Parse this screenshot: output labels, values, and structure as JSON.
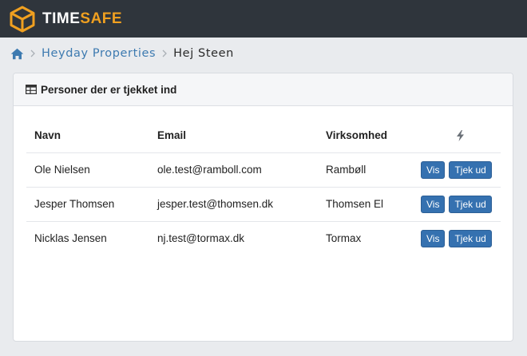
{
  "app": {
    "brand_part1": "TIME",
    "brand_part2": "SAFE",
    "colors": {
      "topbar": "#2f353c",
      "accent": "#f0a020",
      "link": "#3d7ab0",
      "button": "#3571b0"
    }
  },
  "breadcrumb": {
    "home_icon": "home-icon",
    "items": [
      {
        "label": "Heyday Properties"
      },
      {
        "label": "Hej Steen"
      }
    ]
  },
  "card": {
    "icon": "table-icon",
    "title": "Personer der er tjekket ind",
    "columns": {
      "name": "Navn",
      "email": "Email",
      "company": "Virksomhed",
      "actions_icon": "bolt-icon"
    },
    "rows": [
      {
        "name": "Ole Nielsen",
        "email": "ole.test@ramboll.com",
        "company": "Rambøll",
        "view": "Vis",
        "checkout": "Tjek ud"
      },
      {
        "name": "Jesper Thomsen",
        "email": "jesper.test@thomsen.dk",
        "company": "Thomsen El",
        "view": "Vis",
        "checkout": "Tjek ud"
      },
      {
        "name": "Nicklas Jensen",
        "email": "nj.test@tormax.dk",
        "company": "Tormax",
        "view": "Vis",
        "checkout": "Tjek ud"
      }
    ]
  }
}
